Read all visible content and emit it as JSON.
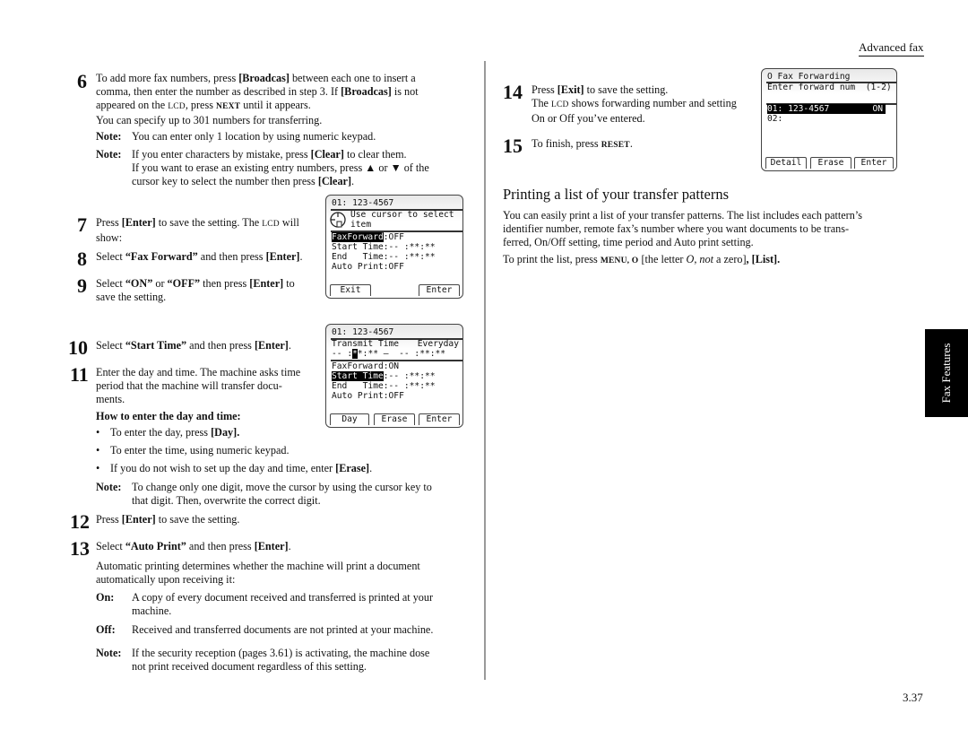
{
  "header": {
    "section": "Advanced fax"
  },
  "side_tab": {
    "label": "Fax Features"
  },
  "page_number": "3.37",
  "left": {
    "step6": {
      "num": "6",
      "l1a": "To add more fax numbers, press ",
      "l1b": "[Broadcas]",
      "l1c": " between each one to insert a",
      "l2a": "comma, then enter the number as described in step 3. If ",
      "l2b": "[Broadcas]",
      "l2c": " is not",
      "l3a": "appeared on the ",
      "l3b": "LCD",
      "l3c": ", press ",
      "l3d": "NEXT",
      "l3e": " until it appears.",
      "l4": "You can specify up to 301 numbers for transferring.",
      "note1_label": "Note:",
      "note1": "You can enter only 1 location by using numeric keypad.",
      "note2_label": "Note:",
      "note2_l1a": "If you enter characters by mistake, press ",
      "note2_l1b": "[Clear]",
      "note2_l1c": " to clear them.",
      "note2_l2": "If you want to erase an existing entry numbers, press ▲ or ▼ of the",
      "note2_l3a": "cursor key to select the number then press ",
      "note2_l3b": "[Clear]",
      "note2_l3c": "."
    },
    "step7": {
      "num": "7",
      "l1a": "Press ",
      "l1b": "[Enter]",
      "l1c": " to save the setting. The ",
      "l1d": "LCD",
      "l1e": " will",
      "l2": "show:"
    },
    "step8": {
      "num": "8",
      "a": "Select ",
      "b": "“Fax Forward”",
      "c": " and then press ",
      "d": "[Enter]",
      "e": "."
    },
    "step9": {
      "num": "9",
      "a": "Select ",
      "b": "“ON”",
      "c": " or ",
      "d": "“OFF”",
      "e": " then press ",
      "f": "[Enter]",
      "g": " to",
      "l2": "save the setting."
    },
    "step10": {
      "num": "10",
      "a": "Select ",
      "b": "“Start Time”",
      "c": " and then press ",
      "d": "[Enter]",
      "e": "."
    },
    "step11": {
      "num": "11",
      "l1": "Enter the day and time. The machine asks time",
      "l2": "period that the machine will transfer docu-",
      "l3": "ments.",
      "subhead": "How to enter the day and time:",
      "bullets": [
        {
          "a": "To enter the day, press ",
          "b": "[Day]",
          "c": "."
        },
        {
          "a": "To enter the time, using numeric keypad.",
          "b": "",
          "c": ""
        },
        {
          "a": "If you do not wish to set up the day and time, enter ",
          "b": "[Erase]",
          "c": "."
        }
      ],
      "note_label": "Note:",
      "note_l1": "To change only one digit, move the cursor by using the cursor key to",
      "note_l2": "that digit. Then, overwrite the correct digit."
    },
    "step12": {
      "num": "12",
      "a": "Press ",
      "b": "[Enter]",
      "c": " to save the setting."
    },
    "step13": {
      "num": "13",
      "a": "Select ",
      "b": "“Auto Print”",
      "c": " and then press ",
      "d": "[Enter]",
      "e": ".",
      "p1": "Automatic printing determines whether the machine will print a document",
      "p2": "automatically upon receiving it:",
      "on_label": "On:",
      "on_l1": "A copy of every document received and transferred is printed at your",
      "on_l2": "machine.",
      "off_label": "Off:",
      "off_l1": "Received and transferred documents are not printed at your machine.",
      "note_label": "Note:",
      "note_l1": "If the security reception (pages 3.61) is activating, the machine dose",
      "note_l2": "not print received document regardless of this setting."
    }
  },
  "lcd1": {
    "line1": "01: 123-4567",
    "hint1": "Use cursor to select",
    "hint2": "item",
    "fax_forward_label": "FaxForward",
    "fax_forward_value": ":OFF",
    "start_time": "Start Time:-- :**:**",
    "end_time": "End   Time:-- :**:**",
    "auto_print": "Auto Print:OFF",
    "buttons": [
      "Exit",
      "Enter"
    ]
  },
  "lcd2": {
    "line1": "01: 123-4567",
    "transmit_label": "Transmit Time",
    "transmit_value": "Everyday",
    "range_a": "-- :",
    "range_cursor": "*",
    "range_b": "*:** –  -- :**:**",
    "fax_forward": "FaxForward:ON",
    "start_label": "Start Time",
    "start_value": ":-- :**:**",
    "end_time": "End   Time:-- :**:**",
    "auto_print": "Auto Print:OFF",
    "buttons": [
      "Day",
      "Erase",
      "Enter"
    ]
  },
  "right": {
    "step14": {
      "num": "14",
      "a": "Press ",
      "b": "[Exit]",
      "c": " to save the setting.",
      "l2a": "The ",
      "l2b": "LCD",
      "l2c": " shows forwarding number and setting",
      "l3": "On or Off you’ve entered."
    },
    "step15": {
      "num": "15",
      "a": "To finish, press ",
      "b": "RESET",
      "c": "."
    },
    "section_title": "Printing a list of your transfer patterns",
    "p1": "You can easily print a list of your transfer patterns. The list includes each pattern’s",
    "p2": "identifier number, remote fax’s number where you want documents to be trans-",
    "p3": "ferred, On/Off setting, time period and Auto print setting.",
    "p4a": "To print the list, press ",
    "p4b": "MENU, O",
    "p4c": " [the letter ",
    "p4d": "O, not",
    "p4e": " a zero]",
    "p4f": ", [List]."
  },
  "lcd3": {
    "title": "O Fax Forwarding",
    "prompt": "Enter forward num  (1-2)",
    "entry1_number": "01: 123-4567",
    "entry1_status": "ON",
    "entry2": "02:",
    "buttons": [
      "Detail",
      "Erase",
      "Enter"
    ]
  }
}
